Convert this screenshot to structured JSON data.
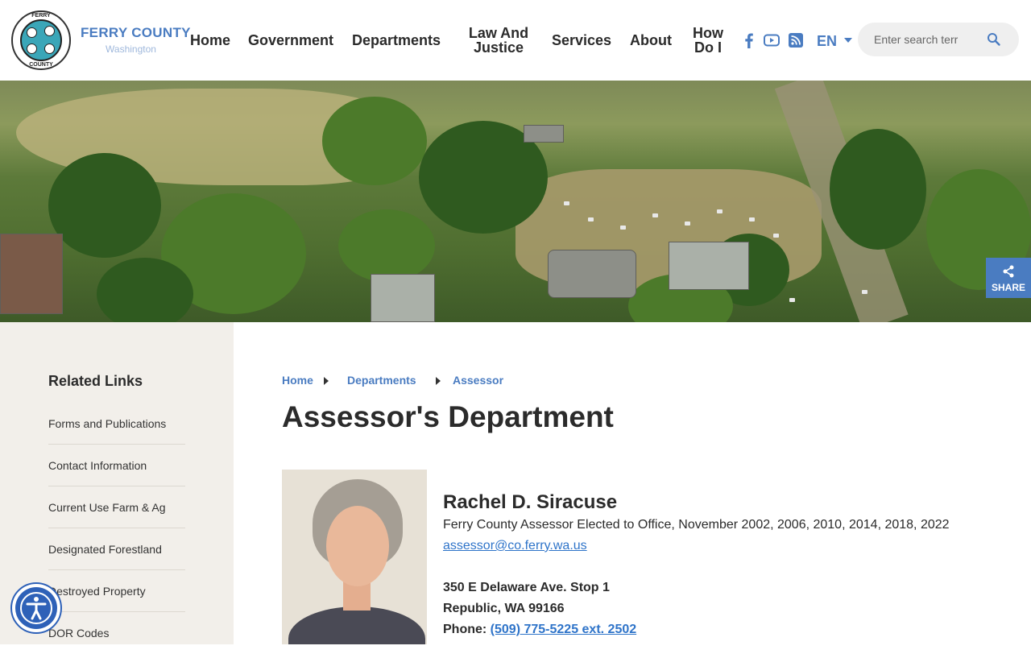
{
  "header": {
    "logo_name": "FERRY COUNTY",
    "logo_sub": "Washington",
    "seal_top": "FERRY",
    "seal_bottom": "COUNTY",
    "nav": [
      {
        "label": "Home"
      },
      {
        "label": "Government"
      },
      {
        "label": "Departments"
      },
      {
        "label_line1": "Law And",
        "label_line2": "Justice"
      },
      {
        "label": "Services"
      },
      {
        "label": "About"
      },
      {
        "label_line1": "How",
        "label_line2": "Do I"
      }
    ],
    "social_icons": [
      "facebook-icon",
      "youtube-icon",
      "rss-icon"
    ],
    "language": "EN",
    "search_placeholder": "Enter search terr"
  },
  "share": {
    "label": "SHARE"
  },
  "sidebar": {
    "title": "Related Links",
    "items": [
      "Forms and Publications",
      "Contact Information",
      "Current Use Farm & Ag",
      "Designated Forestland",
      "Destroyed Property",
      "DOR Codes"
    ]
  },
  "breadcrumb": [
    "Home",
    "Departments",
    "Assessor"
  ],
  "page_title": "Assessor's Department",
  "person": {
    "name": "Rachel D. Siracuse",
    "role": "Ferry County Assessor Elected to Office, November 2002, 2006, 2010, 2014, 2018, 2022",
    "email": "assessor@co.ferry.wa.us",
    "address_line1": "350 E Delaware Ave. Stop 1",
    "address_line2": "Republic, WA  99166",
    "phone_label": "Phone:",
    "phone": "(509) 775-5225 ext. 2502"
  },
  "colors": {
    "brand_blue": "#4a7cc1",
    "link_blue": "#2f74c9",
    "sidebar_bg": "#f2efea",
    "accessibility_blue": "#2e61b8"
  }
}
